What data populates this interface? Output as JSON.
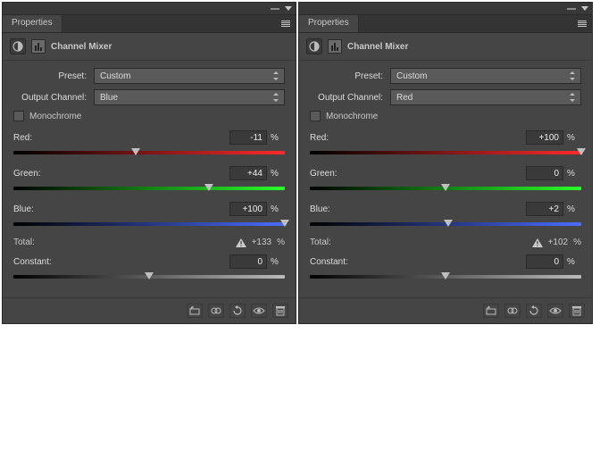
{
  "panels": [
    {
      "tab": "Properties",
      "title": "Channel Mixer",
      "preset_label": "Preset:",
      "preset_value": "Custom",
      "output_label": "Output Channel:",
      "output_value": "Blue",
      "mono_label": "Monochrome",
      "sliders": {
        "red": {
          "label": "Red:",
          "value": "-11",
          "pct": "%",
          "pos": 45
        },
        "green": {
          "label": "Green:",
          "value": "+44",
          "pct": "%",
          "pos": 72
        },
        "blue": {
          "label": "Blue:",
          "value": "+100",
          "pct": "%",
          "pos": 100
        }
      },
      "total": {
        "label": "Total:",
        "value": "+133",
        "pct": "%",
        "warn": true
      },
      "constant": {
        "label": "Constant:",
        "value": "0",
        "pct": "%",
        "pos": 50
      }
    },
    {
      "tab": "Properties",
      "title": "Channel Mixer",
      "preset_label": "Preset:",
      "preset_value": "Custom",
      "output_label": "Output Channel:",
      "output_value": "Red",
      "mono_label": "Monochrome",
      "sliders": {
        "red": {
          "label": "Red:",
          "value": "+100",
          "pct": "%",
          "pos": 100
        },
        "green": {
          "label": "Green:",
          "value": "0",
          "pct": "%",
          "pos": 50
        },
        "blue": {
          "label": "Blue:",
          "value": "+2",
          "pct": "%",
          "pos": 51
        }
      },
      "total": {
        "label": "Total:",
        "value": "+102",
        "pct": "%",
        "warn": true
      },
      "constant": {
        "label": "Constant:",
        "value": "0",
        "pct": "%",
        "pos": 50
      }
    }
  ]
}
